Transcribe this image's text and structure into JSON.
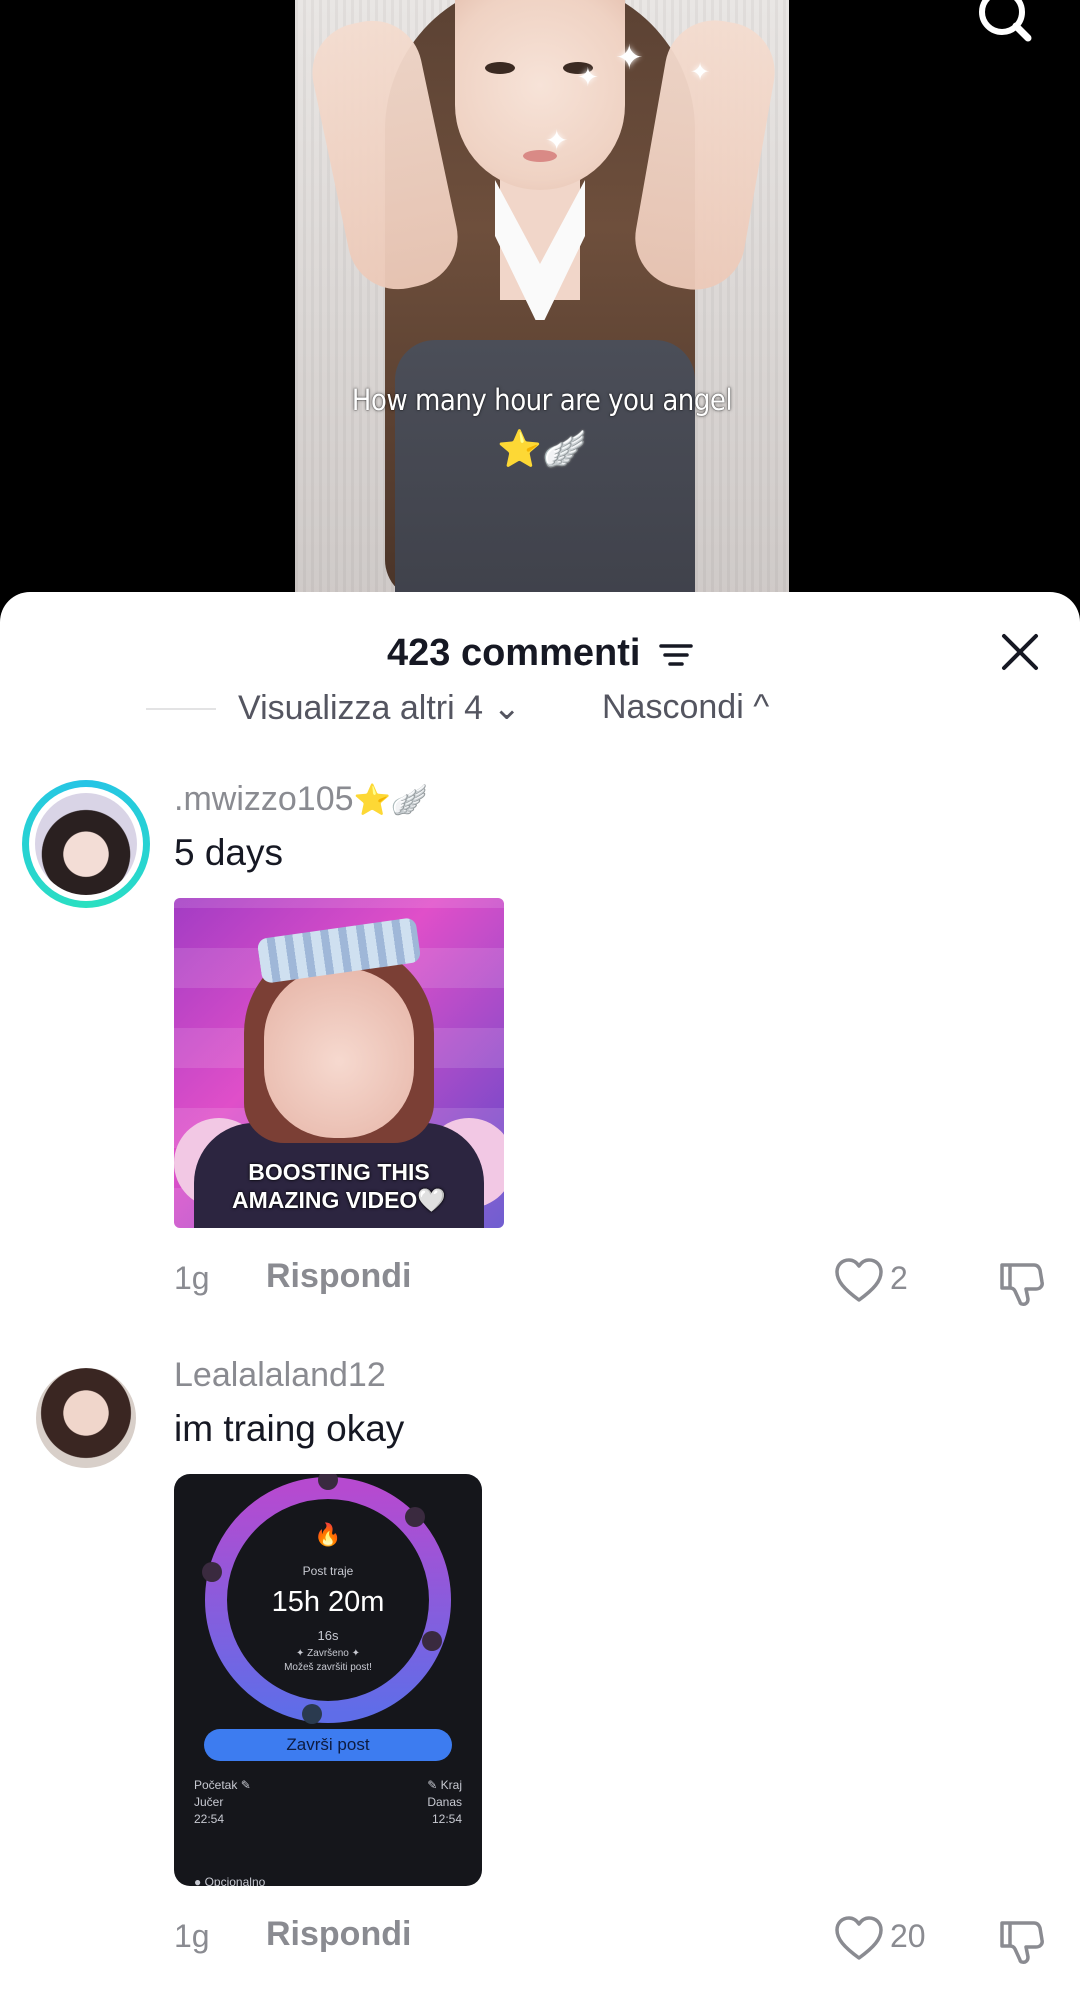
{
  "video": {
    "caption": "How many hour are you angel",
    "caption_emoji": "⭐",
    "caption_wing": "🪽"
  },
  "sheet": {
    "title": "423 commenti",
    "more_replies": "Visualizza altri 4 ⌄",
    "hide": "Nascondi ^"
  },
  "comments": [
    {
      "username": ".mwizzo105",
      "username_deco": "⭐🪽",
      "text": "5 days",
      "attachment_text": [
        "BOOSTING THIS",
        "AMAZING VIDEO🤍"
      ],
      "time": "1g",
      "reply": "Rispondi",
      "likes": "2"
    },
    {
      "username": "Lealalaland12",
      "text": "im traing okay",
      "attachment": {
        "label_top": "Post traje",
        "duration": "15h 20m",
        "seconds": "16s",
        "status": "✦ Završeno ✦",
        "status_sub": "Možeš završiti post!",
        "button": "Završi post",
        "start_label": "Početak ✎",
        "start_day": "Jučer",
        "start_time": "22:54",
        "end_label": "✎ Kraj",
        "end_day": "Danas",
        "end_time": "12:54",
        "footer": "● Opcionalno"
      },
      "time": "1g",
      "reply": "Rispondi",
      "likes": "20"
    }
  ]
}
